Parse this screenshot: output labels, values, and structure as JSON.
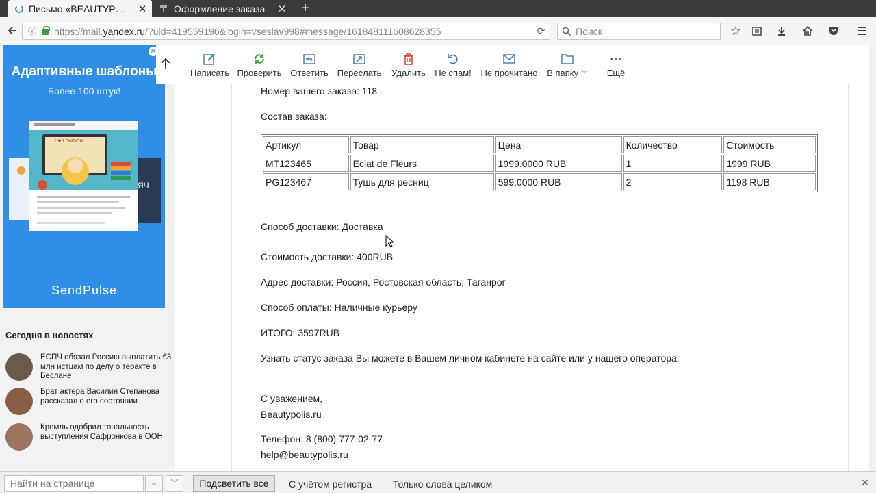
{
  "browser": {
    "tabs": [
      {
        "title": "Письмо «BEAUTYP…",
        "active": true
      },
      {
        "title": "Оформление заказа",
        "active": false
      }
    ],
    "url_prefix": "https://mail.",
    "url_domain": "yandex.ru",
    "url_rest": "/?uid=419559196&login=vseslav998#message/161848111608628355",
    "search_placeholder": "Поиск"
  },
  "ad": {
    "title": "Адаптивные шаблоны",
    "subtitle": "Более 100 штук!",
    "mock_text": "I ❤ LONDON",
    "brand": "SendPulse"
  },
  "news": {
    "heading": "Сегодня в новостях",
    "items": [
      {
        "text": "ЕСПЧ обязал Россию выплатить €3 млн истцам по делу о теракте в Беслане"
      },
      {
        "text": "Брат актера Василия Степанова рассказал о его состоянии"
      },
      {
        "text": "Кремль одобрил тональность выступления Сафронкова в ООН"
      }
    ]
  },
  "toolbar": {
    "buttons": [
      {
        "label": "Написать",
        "icon": "pencil-icon"
      },
      {
        "label": "Проверить",
        "icon": "refresh-icon"
      },
      {
        "label": "Ответить",
        "icon": "reply-icon"
      },
      {
        "label": "Переслать",
        "icon": "forward-icon"
      },
      {
        "label": "Удалить",
        "icon": "trash-icon"
      },
      {
        "label": "Не спам!",
        "icon": "undo-icon"
      },
      {
        "label": "Не прочитано",
        "icon": "envelope-icon"
      },
      {
        "label": "В папку",
        "icon": "folder-icon"
      },
      {
        "label": "Ещё",
        "icon": "more-icon"
      }
    ]
  },
  "letter": {
    "order_number": "Номер вашего заказа: 118 .",
    "composition": "Состав заказа:",
    "table": {
      "headers": [
        "Артикул",
        "Товар",
        "Цена",
        "Количество",
        "Стоимость"
      ],
      "rows": [
        [
          "MT123465",
          "Eclat de Fleurs",
          "1999.0000 RUB",
          "1",
          "1999 RUB"
        ],
        [
          "PG123467",
          "Тушь для ресниц",
          "599.0000 RUB",
          "2",
          "1198 RUB"
        ]
      ]
    },
    "delivery_method": "Способ доставки: Доставка",
    "delivery_cost": "Стоимость доставки: 400RUB",
    "address": "Адрес доставки: Россия, Ростовская область, Таганрог",
    "payment": "Способ оплаты: Наличные курьеру",
    "total": "ИТОГО: 3597RUB",
    "status_note": "Узнать статус заказа Вы можете в Вашем личном кабинете на сайте или у нашего оператора.",
    "regards": "С уважением,",
    "signature": "Beautypolis.ru",
    "phone": "Телефон: 8 (800) 777-02-77",
    "email": "help@beautypolis.ru"
  },
  "findbar": {
    "placeholder": "Найти на странице",
    "highlight_all": "Подсветить все",
    "match_case": "С учётом регистра",
    "whole_words": "Только слова целиком"
  },
  "colors": {
    "ad_blue": "#2f8fe6",
    "toolbar_icon": "#4a7fb5",
    "delete_red": "#e0452f",
    "check_green": "#3ca23c"
  }
}
